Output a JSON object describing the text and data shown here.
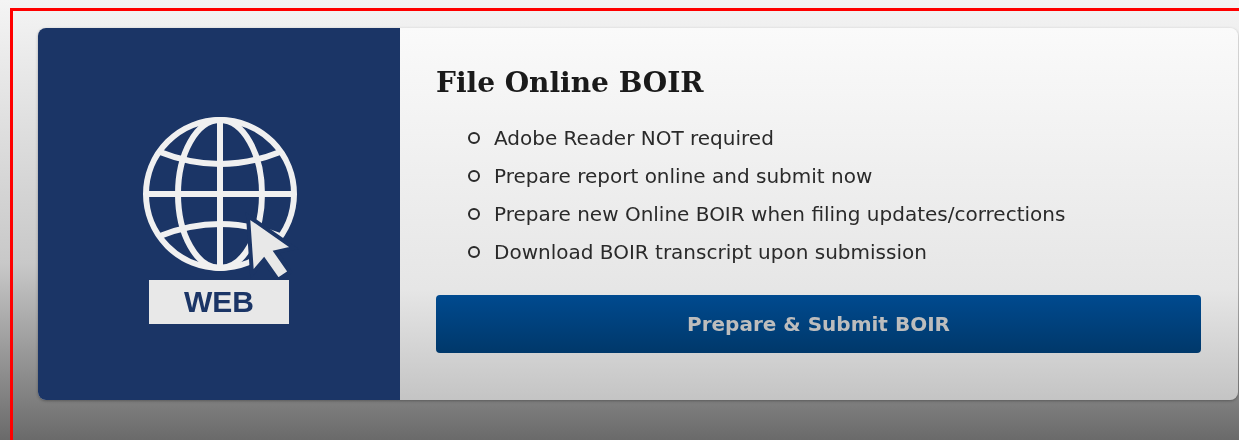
{
  "card": {
    "badge": "WEB",
    "title": "File Online BOIR",
    "bullets": [
      "Adobe Reader NOT required",
      "Prepare report online and submit now",
      "Prepare new Online BOIR when filing updates/corrections",
      "Download BOIR transcript upon submission"
    ],
    "button": "Prepare & Submit BOIR"
  }
}
